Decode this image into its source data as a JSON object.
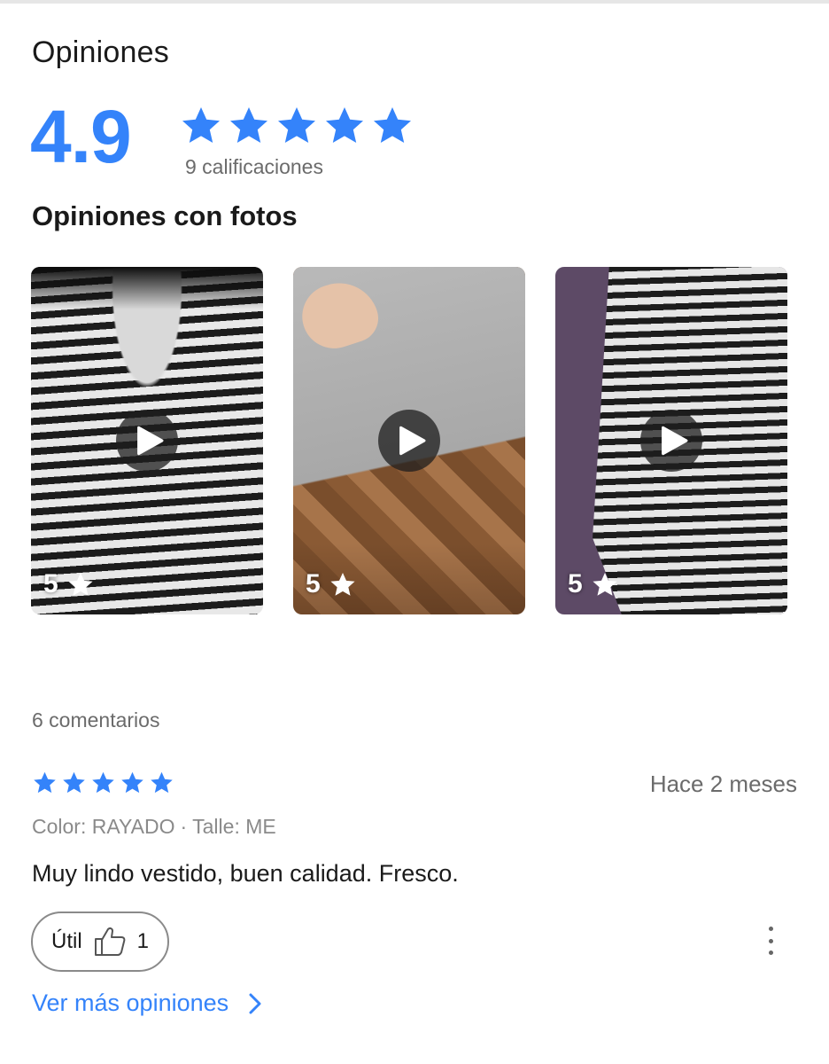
{
  "reviews": {
    "title": "Opiniones",
    "average": "4.9",
    "average_stars": 5,
    "ratings_count": "9 calificaciones",
    "photos_title": "Opiniones con fotos",
    "photos": [
      {
        "score": "5",
        "description": "striped-dress-video"
      },
      {
        "score": "5",
        "description": "grey-fabric-video"
      },
      {
        "score": "5",
        "description": "striped-dress-purple-bg-video"
      }
    ],
    "comments_count": "6 comentarios",
    "review": {
      "stars": 5,
      "date": "Hace 2 meses",
      "color_label": "Color: RAYADO",
      "separator": "·",
      "size_label": "Talle: ME",
      "text": "Muy lindo vestido, buen calidad. Fresco.",
      "useful_label": "Útil",
      "useful_count": "1"
    },
    "see_more": "Ver más opiniones"
  },
  "colors": {
    "accent": "#3483fa",
    "muted_text": "#6b6b6b"
  },
  "icons": [
    "star-icon",
    "play-icon",
    "thumbs-up-icon",
    "more-vertical-icon",
    "chevron-right-icon"
  ]
}
